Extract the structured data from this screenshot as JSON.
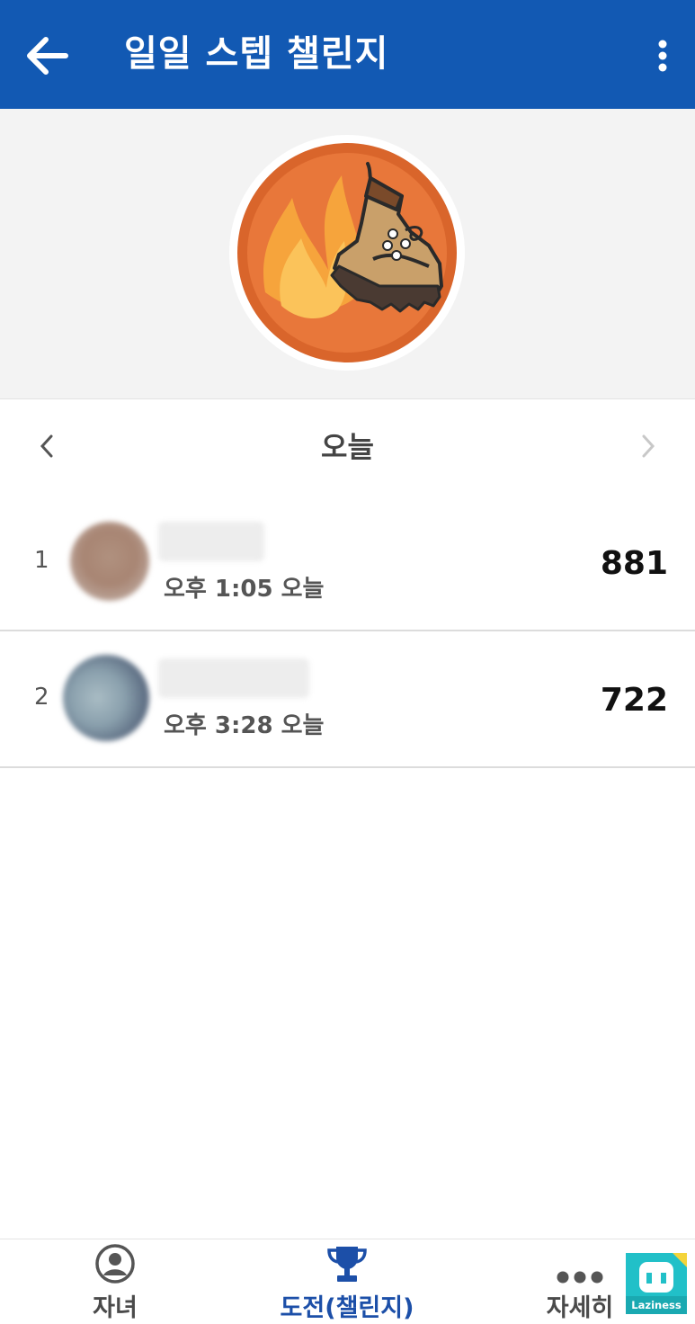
{
  "appbar": {
    "title": "일일 스텝 챌린지"
  },
  "date_nav": {
    "label": "오늘"
  },
  "leaderboard": [
    {
      "rank": "1",
      "time": "오후 1:05 오늘",
      "score": "881"
    },
    {
      "rank": "2",
      "time": "오후 3:28 오늘",
      "score": "722"
    }
  ],
  "bottom_nav": {
    "children_label": "자녀",
    "challenge_label": "도전(챌린지)",
    "more_label": "자세히"
  },
  "watermark": {
    "text": "Laziness"
  },
  "colors": {
    "appbar": "#1259b3",
    "active_tab": "#1c4fa8",
    "badge_outer": "#d9652b",
    "badge_inner": "#e8773a"
  }
}
